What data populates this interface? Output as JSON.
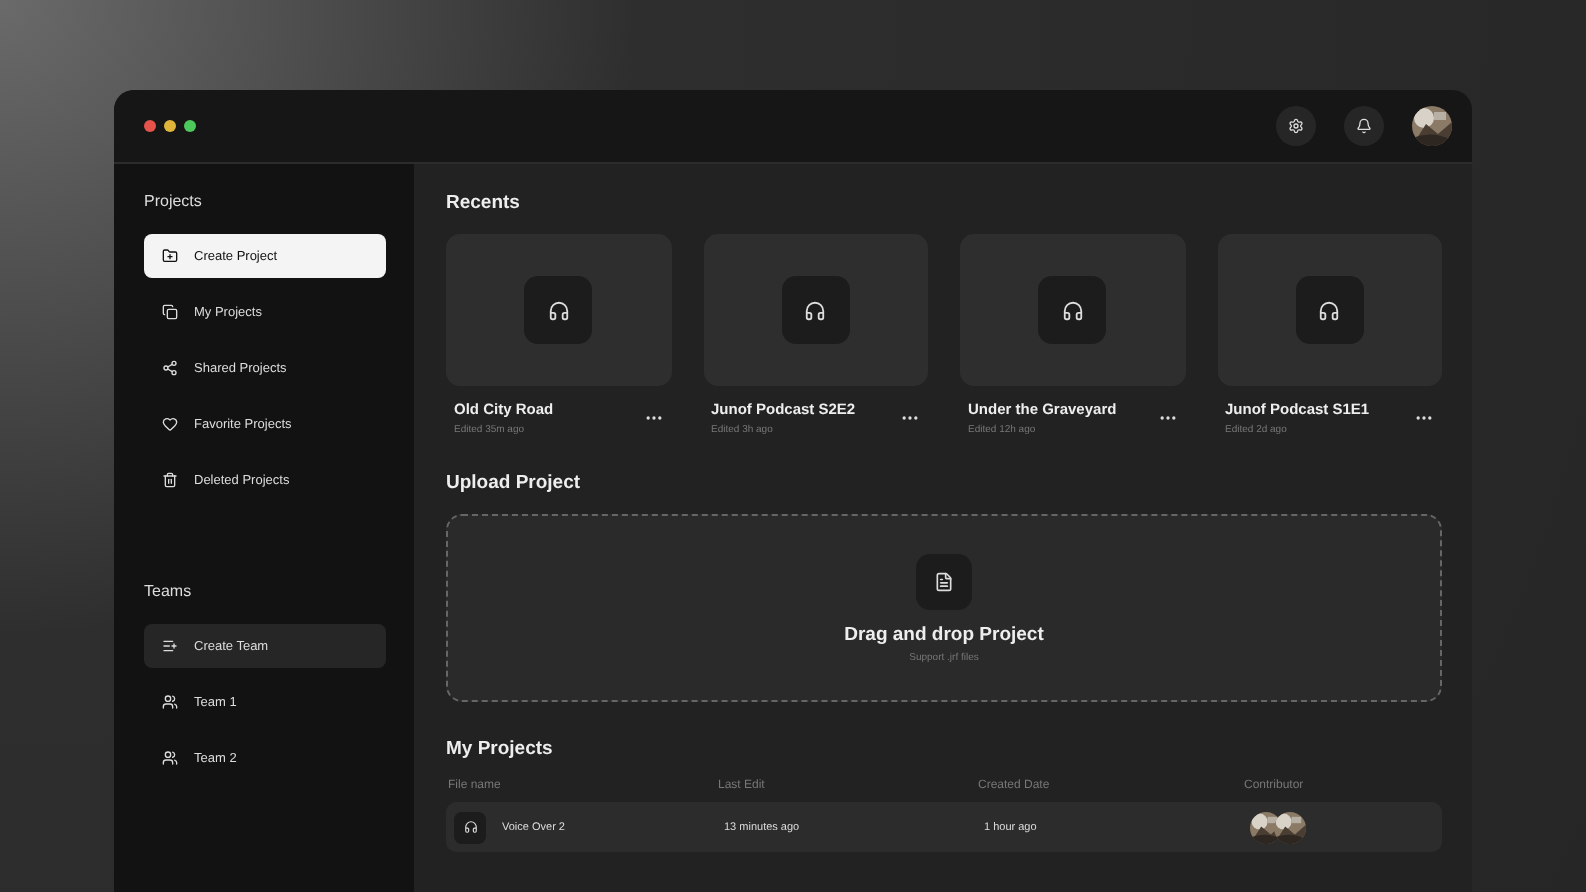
{
  "sidebar": {
    "projects_title": "Projects",
    "project_items": [
      {
        "label": "Create Project",
        "selected": true
      },
      {
        "label": "My Projects",
        "selected": false
      },
      {
        "label": "Shared Projects",
        "selected": false
      },
      {
        "label": "Favorite Projects",
        "selected": false
      },
      {
        "label": "Deleted Projects",
        "selected": false
      }
    ],
    "teams_title": "Teams",
    "team_items": [
      {
        "label": "Create Team",
        "selected": true
      },
      {
        "label": "Team 1",
        "selected": false
      },
      {
        "label": "Team 2",
        "selected": false
      }
    ]
  },
  "recents": {
    "title": "Recents",
    "cards": [
      {
        "name": "Old City Road",
        "edited": "Edited 35m ago"
      },
      {
        "name": "Junof Podcast S2E2",
        "edited": "Edited 3h ago"
      },
      {
        "name": "Under the Graveyard",
        "edited": "Edited 12h ago"
      },
      {
        "name": "Junof Podcast S1E1",
        "edited": "Edited 2d ago"
      }
    ]
  },
  "upload": {
    "title": "Upload Project",
    "drop_title": "Drag and drop Project",
    "drop_hint": "Support .jrf files"
  },
  "my_projects": {
    "title": "My Projects",
    "columns": [
      "File name",
      "Last Edit",
      "Created Date",
      "Contributor"
    ],
    "rows": [
      {
        "name": "Voice Over 2",
        "last_edit": "13 minutes ago",
        "created": "1 hour ago"
      }
    ]
  }
}
